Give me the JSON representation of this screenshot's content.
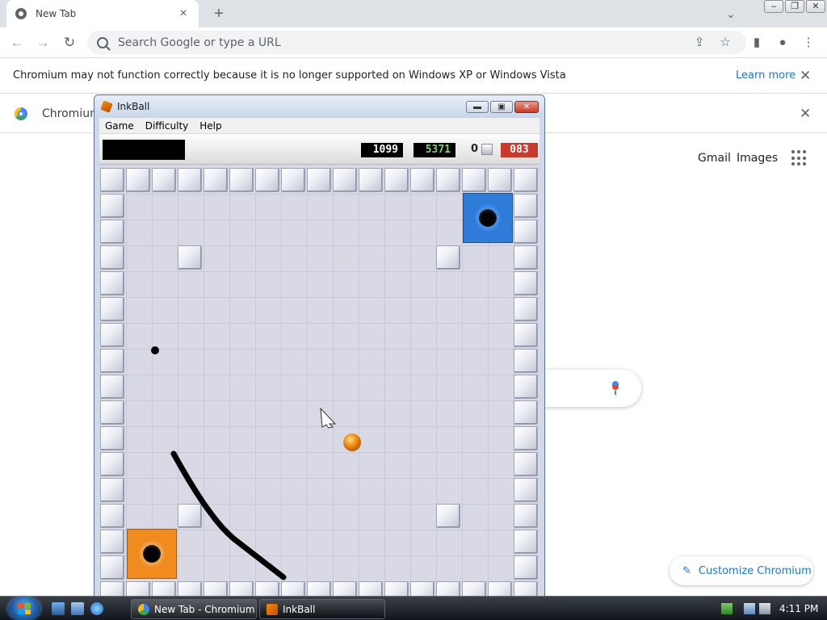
{
  "browser": {
    "tab": {
      "title": "New Tab",
      "close": "×"
    },
    "new_tab": "+",
    "tab_list": "⌄",
    "window_controls": {
      "minimize": "–",
      "maximize": "❐",
      "close": "✕"
    },
    "nav": {
      "back": "←",
      "forward": "→",
      "reload": "↻"
    },
    "omnibox_placeholder": "Search Google or type a URL",
    "toolbar_icons": {
      "share": "⇪",
      "bookmark": "☆",
      "side_panel": "▮",
      "profile": "●",
      "menu": "⋮"
    }
  },
  "infobar_unsupported": {
    "message": "Chromium may not function correctly because it is no longer supported on Windows XP or Windows Vista",
    "link": "Learn more",
    "close": "✕"
  },
  "infobar_default": {
    "label": "Chromium",
    "close": "✕"
  },
  "ntp": {
    "links": [
      "Gmail",
      "Images"
    ],
    "customize_label": "Customize Chromium",
    "customize_icon": "✎"
  },
  "inkball": {
    "title": "InkBall",
    "controls": {
      "minimize": "▬",
      "maximize": "▣",
      "close": "✕"
    },
    "menu": [
      "Game",
      "Difficulty",
      "Help"
    ],
    "score_white": "1099",
    "score_green": "5371",
    "balls_count": "0",
    "timer": "083",
    "colors": {
      "score_green": "#7fd36b",
      "timer_bg": "#c93a2c",
      "hole_blue": "#2f7cd8",
      "hole_orange": "#f08c1e",
      "ball_orange": "#f08c1e"
    }
  },
  "taskbar": {
    "tasks": [
      "New Tab - Chromium",
      "InkBall"
    ],
    "clock": "4:11 PM"
  }
}
